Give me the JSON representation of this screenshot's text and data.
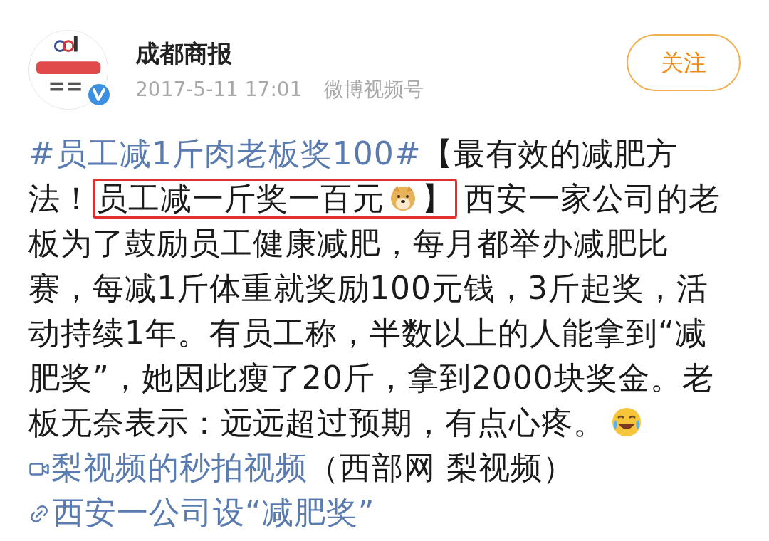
{
  "author": {
    "name": "成都商报",
    "timestamp": "2017-5-11 17:01",
    "source": "微博视频号",
    "verified": true
  },
  "follow_button": {
    "label": "关注"
  },
  "post": {
    "segments": [
      {
        "kind": "hashtag",
        "text": "#员工减1斤肉老板奖100#"
      },
      {
        "kind": "text",
        "text": "【最有效的减肥方法！"
      },
      {
        "kind": "highlight",
        "text": "员工减一斤奖一百元",
        "closing": "】"
      },
      {
        "kind": "text",
        "text": "西安一家公司的老板为了鼓励员工健康减肥，每月都举办减肥比赛，每减1斤体重就奖励100元钱，3斤起奖，活动持续1年。有员工称，半数以上的人能拿到“减肥奖”，她因此瘦了20斤，拿到2000块奖金。老板无奈表示：远远超过预期，有点心疼。"
      },
      {
        "kind": "emoji"
      },
      {
        "kind": "video_link",
        "text": "梨视频的秒拍视频"
      },
      {
        "kind": "text",
        "text": "（西部网 梨视频）"
      },
      {
        "kind": "web_link",
        "text": "西安一公司设“减肥奖”"
      }
    ]
  }
}
